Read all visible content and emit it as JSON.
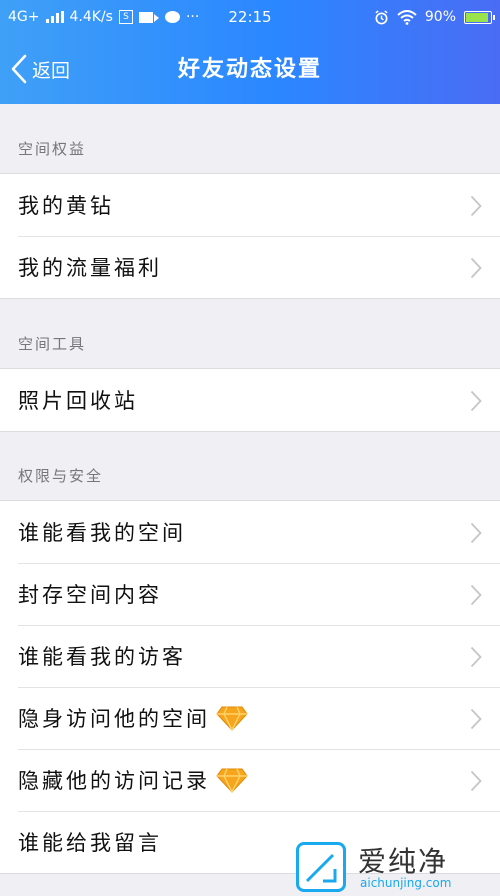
{
  "status_bar": {
    "network": "4G+",
    "speed": "4.4K/s",
    "s_icon_label": "S",
    "time": "22:15",
    "battery": "90%",
    "battery_level": 0.9
  },
  "nav": {
    "back_label": "返回",
    "title": "好友动态设置"
  },
  "sections": [
    {
      "header": "空间权益",
      "items": [
        "我的黄钻",
        "我的流量福利"
      ]
    },
    {
      "header": "空间工具",
      "items": [
        "照片回收站"
      ]
    },
    {
      "header": "权限与安全",
      "items": [
        "谁能看我的空间",
        "封存空间内容",
        "谁能看我的访客",
        "隐身访问他的空间",
        "隐藏他的访问记录",
        "谁能给我留言"
      ]
    }
  ],
  "watermark": {
    "cn": "爱纯净",
    "en": "aichunjing.com"
  },
  "colors": {
    "header_start": "#3fa0f7",
    "header_end": "#4a6cf5",
    "diamond": "#f7a51c",
    "background": "#efeff4"
  },
  "icons": {
    "back": "chevron-left-icon",
    "row_arrow": "chevron-right-icon",
    "vip": "yellow-diamond-icon"
  }
}
